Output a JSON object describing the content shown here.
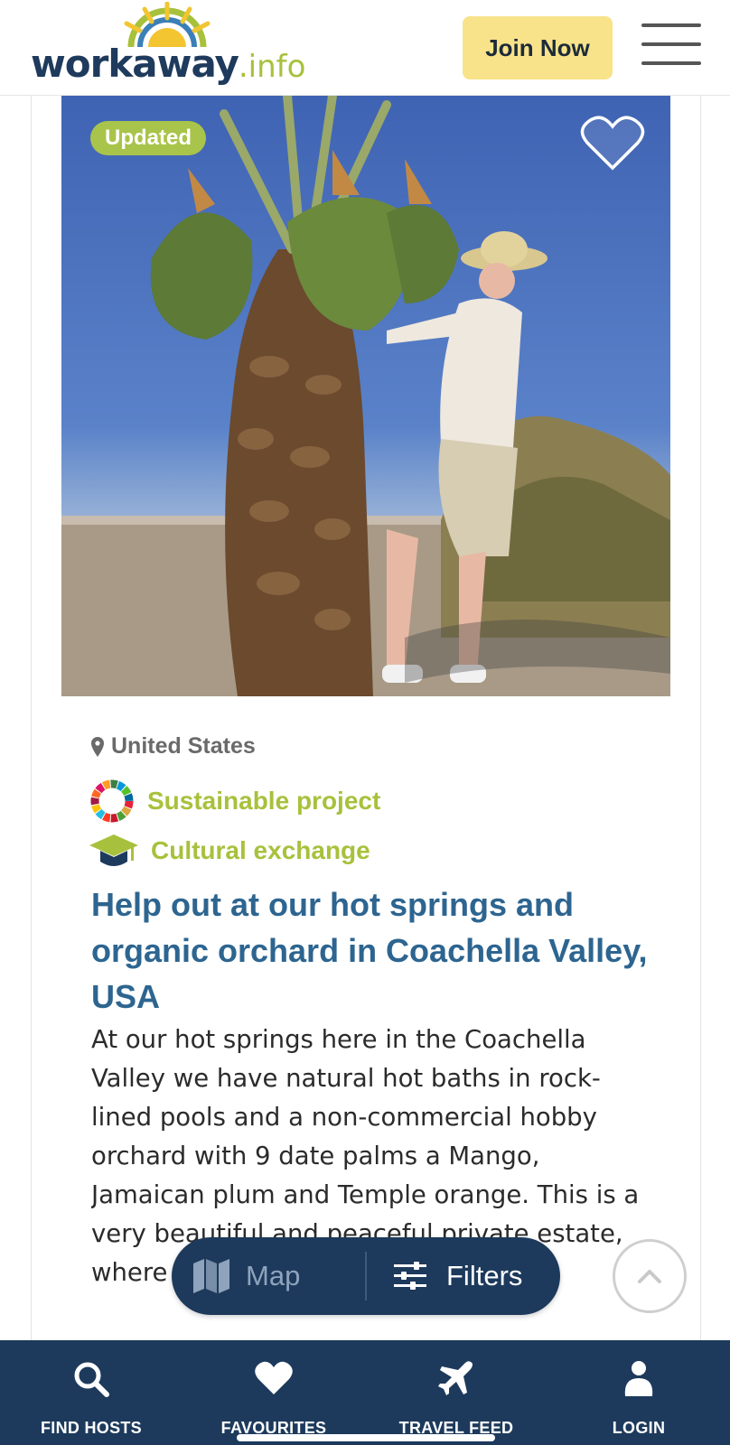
{
  "header": {
    "logo_main": "workaway",
    "logo_tld": ".info",
    "join_label": "Join Now"
  },
  "listing": {
    "badge": "Updated",
    "location": "United States",
    "tags": [
      "Sustainable project",
      "Cultural exchange"
    ],
    "title": "Help out at our hot springs and organic orchard in Coachella Valley, USA",
    "description": "At our hot springs here in the Coachella Valley we have natural hot baths in rock-lined pools and a non-commercial hobby orchard with 9 date palms a Mango, Jamaican plum and Temple orange. This is a very beautiful and peaceful private estate, where ..."
  },
  "pill": {
    "map_label": "Map",
    "filters_label": "Filters"
  },
  "bottom_nav": {
    "items": [
      {
        "label": "FIND HOSTS",
        "icon": "search-icon"
      },
      {
        "label": "FAVOURITES",
        "icon": "heart-icon"
      },
      {
        "label": "TRAVEL FEED",
        "icon": "airplane-icon"
      },
      {
        "label": "LOGIN",
        "icon": "user-icon"
      }
    ]
  },
  "colors": {
    "brand_navy": "#1d3a5c",
    "brand_green": "#a7c13c",
    "join_yellow": "#f8e38a",
    "title_blue": "#2d6590"
  }
}
